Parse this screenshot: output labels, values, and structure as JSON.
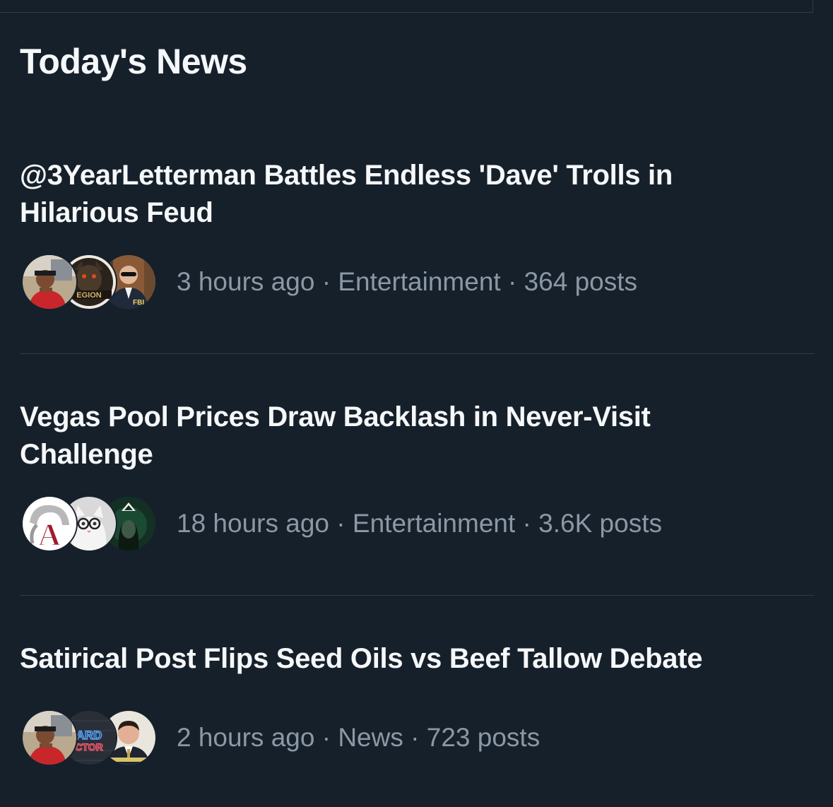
{
  "section": {
    "title": "Today's News"
  },
  "items": [
    {
      "headline": "@3YearLetterman Battles Endless 'Dave' Trolls in Hilarious Feud",
      "time": "3 hours ago",
      "category": "Entertainment",
      "posts": "364 posts",
      "avatar_texts": [
        "EGION",
        "FBI"
      ]
    },
    {
      "headline": "Vegas Pool Prices Draw Backlash in Never-Visit Challenge",
      "time": "18 hours ago",
      "category": "Entertainment",
      "posts": "3.6K posts",
      "avatar_texts": [
        "A"
      ]
    },
    {
      "headline": "Satirical Post Flips Seed Oils vs Beef Tallow Debate",
      "time": "2 hours ago",
      "category": "News",
      "posts": "723 posts",
      "avatar_texts": [
        "ARD",
        "CTOR"
      ]
    }
  ],
  "separator": " · ",
  "colors": {
    "background": "#16202b",
    "headline": "#f5f7f8",
    "meta": "#8b98a5",
    "divider": "#2f3b47"
  }
}
